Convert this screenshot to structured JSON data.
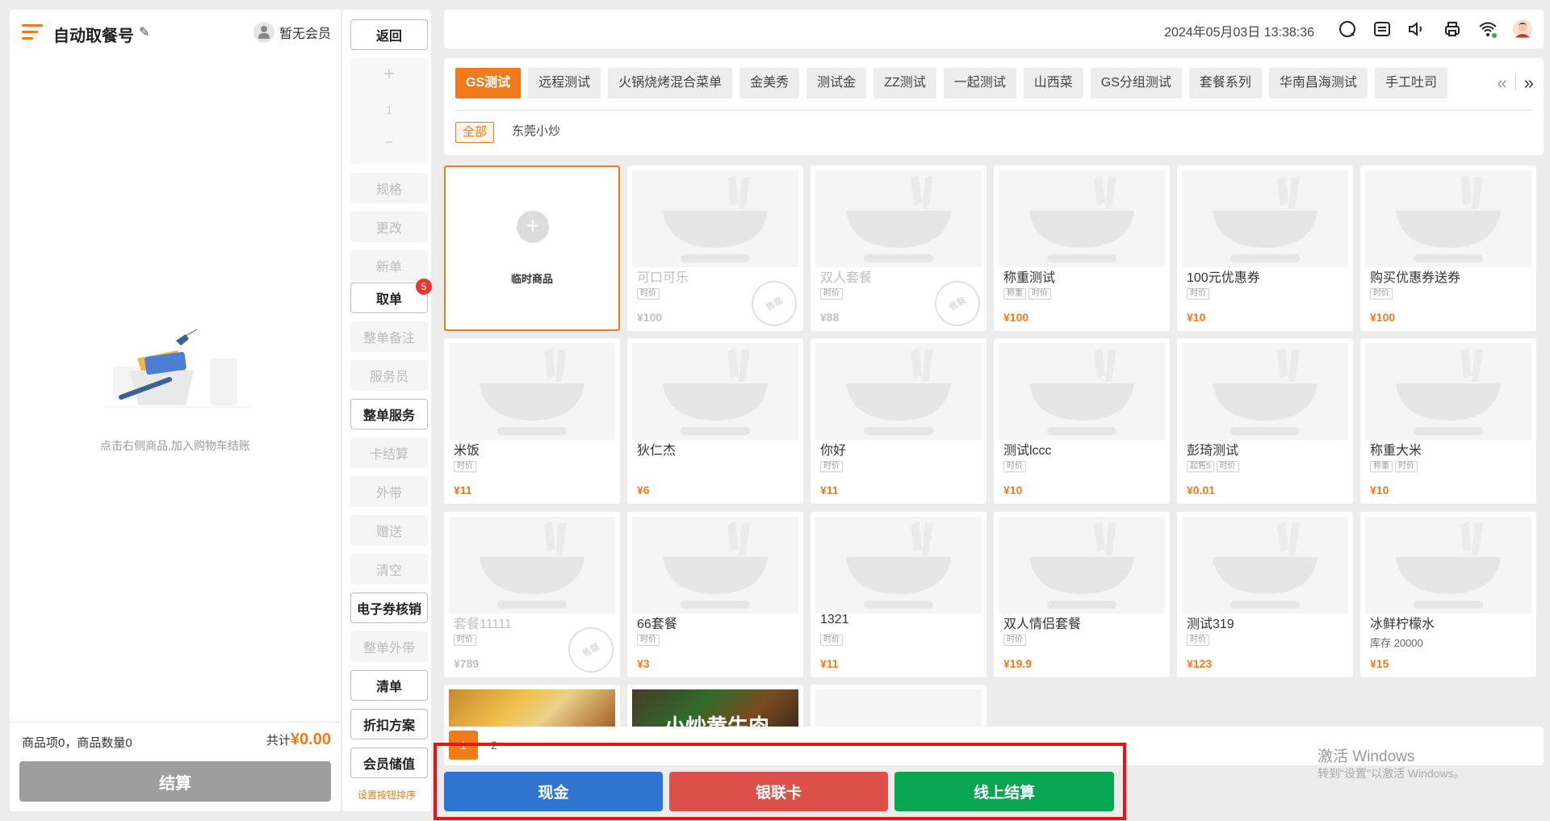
{
  "cart": {
    "title": "自动取餐号",
    "member": "暂无会员",
    "empty_text": "点击右侧商品,加入购物车结账",
    "summary": "商品项0，商品数量0",
    "total_label": "共计",
    "total_value": "¥0.00",
    "checkout": "结算"
  },
  "actions": {
    "back": "返回",
    "qty_plus": "+",
    "qty_value": "1",
    "qty_minus": "−",
    "spec": "规格",
    "modify": "更改",
    "new": "新单",
    "take": "取单",
    "take_badge": "5",
    "order_note": "整单备注",
    "waiter": "服务员",
    "order_service": "整单服务",
    "card_pay": "卡结算",
    "takeout": "外带",
    "gift": "赠送",
    "clear": "清空",
    "ecoupon": "电子券核销",
    "order_takeout": "整单外带",
    "clear_list": "清单",
    "discount": "折扣方案",
    "member_deposit": "会员储值",
    "sort_link": "设置按钮排序"
  },
  "topbar": {
    "datetime": "2024年05月03日 13:38:36",
    "icons": [
      "search-icon",
      "list-icon",
      "volume-icon",
      "printer-icon",
      "wifi-icon",
      "avatar"
    ]
  },
  "categories": [
    "GS测试",
    "远程测试",
    "火锅烧烤混合菜单",
    "金美秀",
    "测试金",
    "ZZ测试",
    "一起测试",
    "山西菜",
    "GS分组测试",
    "套餐系列",
    "华南昌海测试",
    "手工吐司"
  ],
  "active_category": "GS测试",
  "subcategories": [
    "全部",
    "东莞小炒"
  ],
  "active_subcategory": "全部",
  "temp_item": "临时商品",
  "products": [
    {
      "name": "可口可乐",
      "tags": [
        "时价"
      ],
      "price": "¥100",
      "soldout": true
    },
    {
      "name": "双人套餐",
      "tags": [
        "时价"
      ],
      "price": "¥88",
      "soldout": true
    },
    {
      "name": "称重测试",
      "tags": [
        "称重",
        "时价"
      ],
      "price": "¥100"
    },
    {
      "name": "100元优惠券",
      "tags": [
        "时价"
      ],
      "price": "¥10"
    },
    {
      "name": "购买优惠券送券",
      "tags": [
        "时价"
      ],
      "price": "¥100"
    },
    {
      "name": "米饭",
      "tags": [
        "时价"
      ],
      "price": "¥11"
    },
    {
      "name": "狄仁杰",
      "tags": [],
      "price": "¥6"
    },
    {
      "name": "你好",
      "tags": [
        "时价"
      ],
      "price": "¥11"
    },
    {
      "name": "测试lccc",
      "tags": [
        "时价"
      ],
      "price": "¥10"
    },
    {
      "name": "彭琦测试",
      "tags": [
        "起售5",
        "时价"
      ],
      "price": "¥0.01"
    },
    {
      "name": "称重大米",
      "tags": [
        "称重",
        "时价"
      ],
      "price": "¥10"
    },
    {
      "name": "套餐11111",
      "tags": [
        "时价"
      ],
      "price": "¥789",
      "soldout": true
    },
    {
      "name": "66套餐",
      "tags": [
        "时价"
      ],
      "price": "¥3"
    },
    {
      "name": "1321",
      "tags": [
        "时价"
      ],
      "price": "¥11"
    },
    {
      "name": "双人情侣套餐",
      "tags": [
        "时价"
      ],
      "price": "¥19.9"
    },
    {
      "name": "测试319",
      "tags": [
        "时价"
      ],
      "price": "¥123"
    },
    {
      "name": "冰鲜柠檬水",
      "tags": [],
      "stock": "库存  20000",
      "price": "¥15"
    }
  ],
  "partial_products": [
    {
      "caption": ""
    },
    {
      "caption": "小炒黄牛肉"
    },
    {
      "caption": ""
    }
  ],
  "soldout_label": "售罄",
  "pagination": {
    "pages": [
      "1",
      "2"
    ],
    "current": "1"
  },
  "payments": {
    "cash": "现金",
    "unionpay": "银联卡",
    "online": "线上结算"
  },
  "colors": {
    "accent": "#f27a1a",
    "cash": "#2f75d0",
    "unionpay": "#db5149",
    "online": "#08a653",
    "highlight": "#ee1111"
  },
  "watermark": {
    "line1": "激活 Windows",
    "line2": "转到\"设置\"以激活 Windows。"
  }
}
